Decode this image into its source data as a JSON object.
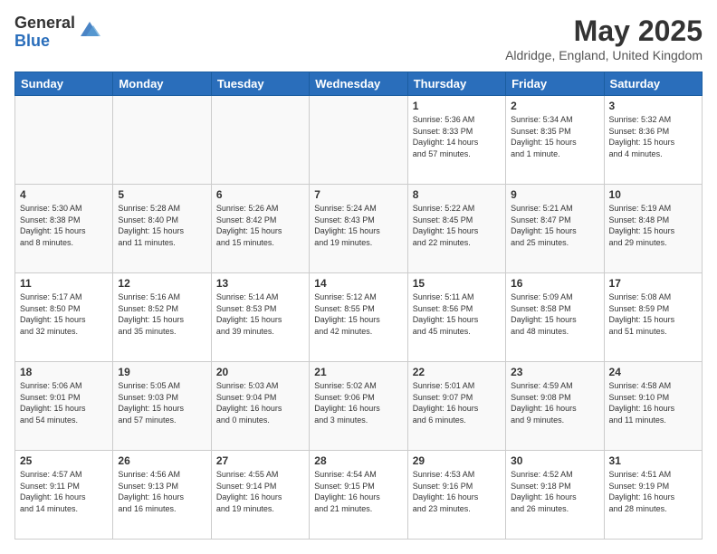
{
  "header": {
    "logo_general": "General",
    "logo_blue": "Blue",
    "month_title": "May 2025",
    "location": "Aldridge, England, United Kingdom"
  },
  "weekdays": [
    "Sunday",
    "Monday",
    "Tuesday",
    "Wednesday",
    "Thursday",
    "Friday",
    "Saturday"
  ],
  "weeks": [
    [
      {
        "day": "",
        "info": ""
      },
      {
        "day": "",
        "info": ""
      },
      {
        "day": "",
        "info": ""
      },
      {
        "day": "",
        "info": ""
      },
      {
        "day": "1",
        "info": "Sunrise: 5:36 AM\nSunset: 8:33 PM\nDaylight: 14 hours\nand 57 minutes."
      },
      {
        "day": "2",
        "info": "Sunrise: 5:34 AM\nSunset: 8:35 PM\nDaylight: 15 hours\nand 1 minute."
      },
      {
        "day": "3",
        "info": "Sunrise: 5:32 AM\nSunset: 8:36 PM\nDaylight: 15 hours\nand 4 minutes."
      }
    ],
    [
      {
        "day": "4",
        "info": "Sunrise: 5:30 AM\nSunset: 8:38 PM\nDaylight: 15 hours\nand 8 minutes."
      },
      {
        "day": "5",
        "info": "Sunrise: 5:28 AM\nSunset: 8:40 PM\nDaylight: 15 hours\nand 11 minutes."
      },
      {
        "day": "6",
        "info": "Sunrise: 5:26 AM\nSunset: 8:42 PM\nDaylight: 15 hours\nand 15 minutes."
      },
      {
        "day": "7",
        "info": "Sunrise: 5:24 AM\nSunset: 8:43 PM\nDaylight: 15 hours\nand 19 minutes."
      },
      {
        "day": "8",
        "info": "Sunrise: 5:22 AM\nSunset: 8:45 PM\nDaylight: 15 hours\nand 22 minutes."
      },
      {
        "day": "9",
        "info": "Sunrise: 5:21 AM\nSunset: 8:47 PM\nDaylight: 15 hours\nand 25 minutes."
      },
      {
        "day": "10",
        "info": "Sunrise: 5:19 AM\nSunset: 8:48 PM\nDaylight: 15 hours\nand 29 minutes."
      }
    ],
    [
      {
        "day": "11",
        "info": "Sunrise: 5:17 AM\nSunset: 8:50 PM\nDaylight: 15 hours\nand 32 minutes."
      },
      {
        "day": "12",
        "info": "Sunrise: 5:16 AM\nSunset: 8:52 PM\nDaylight: 15 hours\nand 35 minutes."
      },
      {
        "day": "13",
        "info": "Sunrise: 5:14 AM\nSunset: 8:53 PM\nDaylight: 15 hours\nand 39 minutes."
      },
      {
        "day": "14",
        "info": "Sunrise: 5:12 AM\nSunset: 8:55 PM\nDaylight: 15 hours\nand 42 minutes."
      },
      {
        "day": "15",
        "info": "Sunrise: 5:11 AM\nSunset: 8:56 PM\nDaylight: 15 hours\nand 45 minutes."
      },
      {
        "day": "16",
        "info": "Sunrise: 5:09 AM\nSunset: 8:58 PM\nDaylight: 15 hours\nand 48 minutes."
      },
      {
        "day": "17",
        "info": "Sunrise: 5:08 AM\nSunset: 8:59 PM\nDaylight: 15 hours\nand 51 minutes."
      }
    ],
    [
      {
        "day": "18",
        "info": "Sunrise: 5:06 AM\nSunset: 9:01 PM\nDaylight: 15 hours\nand 54 minutes."
      },
      {
        "day": "19",
        "info": "Sunrise: 5:05 AM\nSunset: 9:03 PM\nDaylight: 15 hours\nand 57 minutes."
      },
      {
        "day": "20",
        "info": "Sunrise: 5:03 AM\nSunset: 9:04 PM\nDaylight: 16 hours\nand 0 minutes."
      },
      {
        "day": "21",
        "info": "Sunrise: 5:02 AM\nSunset: 9:06 PM\nDaylight: 16 hours\nand 3 minutes."
      },
      {
        "day": "22",
        "info": "Sunrise: 5:01 AM\nSunset: 9:07 PM\nDaylight: 16 hours\nand 6 minutes."
      },
      {
        "day": "23",
        "info": "Sunrise: 4:59 AM\nSunset: 9:08 PM\nDaylight: 16 hours\nand 9 minutes."
      },
      {
        "day": "24",
        "info": "Sunrise: 4:58 AM\nSunset: 9:10 PM\nDaylight: 16 hours\nand 11 minutes."
      }
    ],
    [
      {
        "day": "25",
        "info": "Sunrise: 4:57 AM\nSunset: 9:11 PM\nDaylight: 16 hours\nand 14 minutes."
      },
      {
        "day": "26",
        "info": "Sunrise: 4:56 AM\nSunset: 9:13 PM\nDaylight: 16 hours\nand 16 minutes."
      },
      {
        "day": "27",
        "info": "Sunrise: 4:55 AM\nSunset: 9:14 PM\nDaylight: 16 hours\nand 19 minutes."
      },
      {
        "day": "28",
        "info": "Sunrise: 4:54 AM\nSunset: 9:15 PM\nDaylight: 16 hours\nand 21 minutes."
      },
      {
        "day": "29",
        "info": "Sunrise: 4:53 AM\nSunset: 9:16 PM\nDaylight: 16 hours\nand 23 minutes."
      },
      {
        "day": "30",
        "info": "Sunrise: 4:52 AM\nSunset: 9:18 PM\nDaylight: 16 hours\nand 26 minutes."
      },
      {
        "day": "31",
        "info": "Sunrise: 4:51 AM\nSunset: 9:19 PM\nDaylight: 16 hours\nand 28 minutes."
      }
    ]
  ]
}
